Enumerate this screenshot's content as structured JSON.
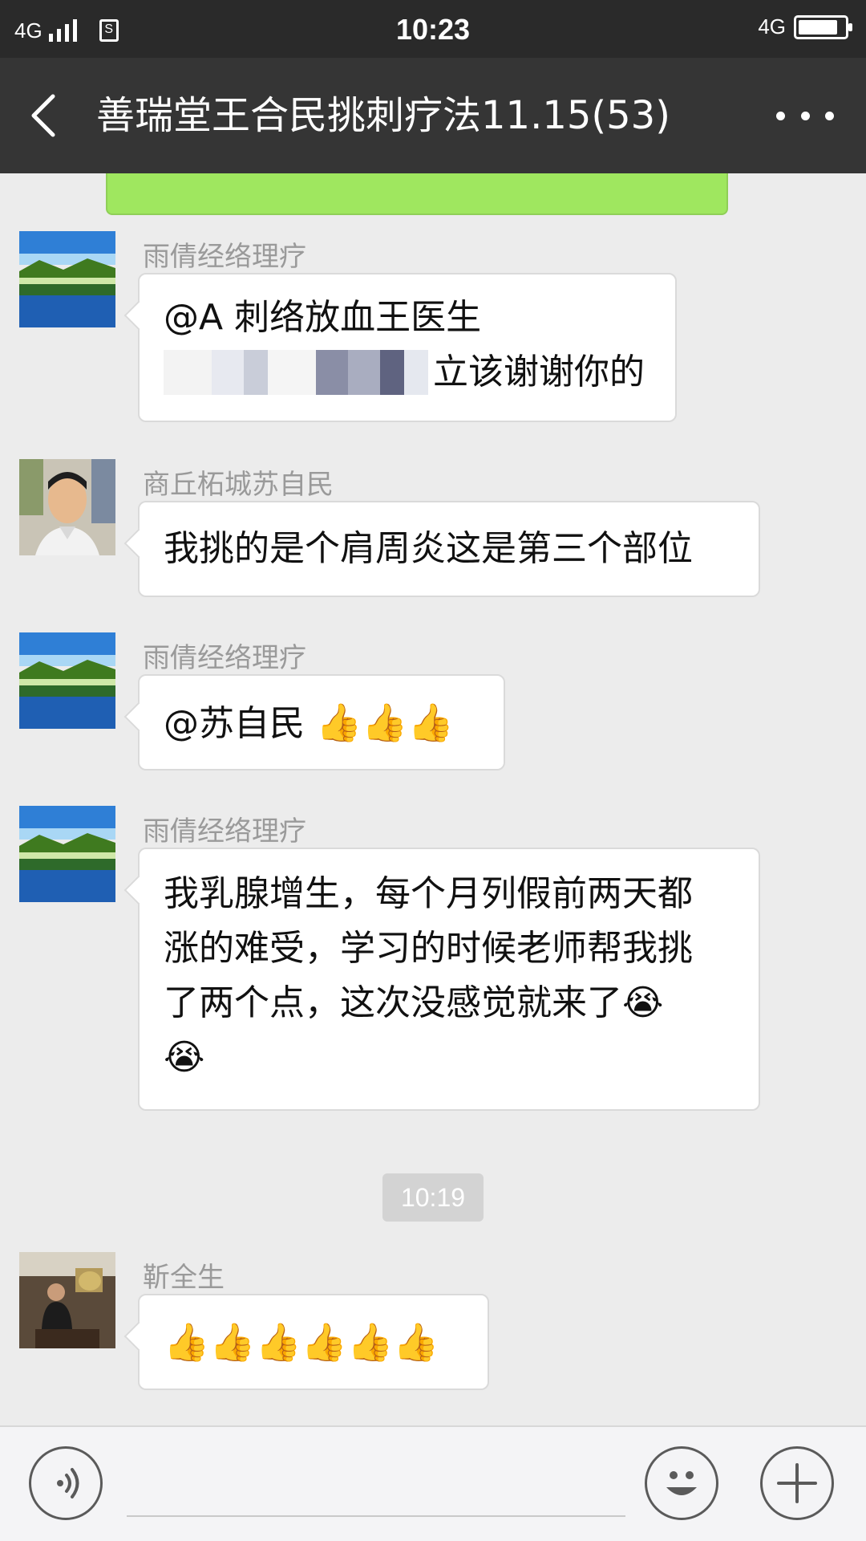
{
  "status_bar": {
    "network_left": "4G",
    "sim_label": "S",
    "time": "10:23",
    "network_right": "4G",
    "battery_level": 0.85
  },
  "header": {
    "title": "善瑞堂王合民挑刺疗法11.15(53)",
    "back_icon": "chevron-left-icon",
    "more_icon": "more-dots-icon"
  },
  "messages": [
    {
      "sender": "雨倩经络理疗",
      "avatar": "lake-landscape",
      "line1": "@A 刺络放血王医生",
      "line2_visible": "立该谢谢你的"
    },
    {
      "sender": "商丘柘城苏自民",
      "avatar": "man-portrait",
      "text": "我挑的是个肩周炎这是第三个部位"
    },
    {
      "sender": "雨倩经络理疗",
      "avatar": "lake-landscape",
      "text": "@苏自民 ",
      "emoji": "👍👍👍"
    },
    {
      "sender": "雨倩经络理疗",
      "avatar": "lake-landscape",
      "lines": [
        "我乳腺增生，每个月列假前两天都",
        "涨的难受，学习的时候老师帮我挑",
        "了两个点，这次没感觉就来了😭",
        "😭"
      ]
    },
    {
      "sender": "靳全生",
      "avatar": "seated-man-photo",
      "emoji": "👍👍👍👍👍👍"
    }
  ],
  "time_divider": "10:19",
  "input_bar": {
    "voice_icon": "voice-icon",
    "emoji_icon": "smiley-icon",
    "plus_icon": "plus-icon"
  },
  "colors": {
    "status_bar_bg": "#2a2a2a",
    "title_bar_bg": "#353535",
    "chat_bg": "#ececec",
    "sent_bubble": "#9fe75f",
    "received_bubble": "#ffffff"
  }
}
